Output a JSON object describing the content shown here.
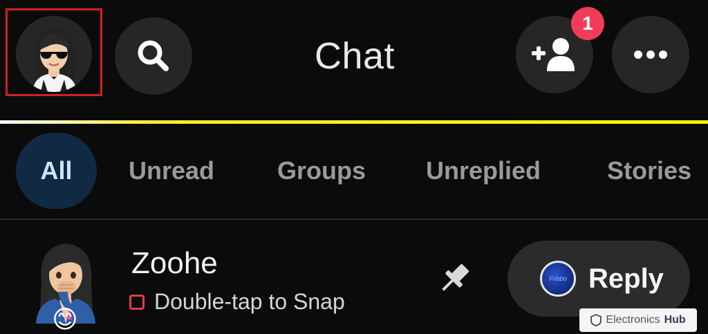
{
  "header": {
    "title": "Chat",
    "notification_count": "1"
  },
  "tabs": [
    {
      "label": "All",
      "selected": true
    },
    {
      "label": "Unread",
      "selected": false
    },
    {
      "label": "Groups",
      "selected": false
    },
    {
      "label": "Unreplied",
      "selected": false
    },
    {
      "label": "Stories",
      "selected": false
    }
  ],
  "chat": {
    "name": "Zoohe",
    "status": "Double-tap to Snap",
    "emoji": "😊",
    "reply_label": "Reply",
    "reply_thumb_text": "Fribbo"
  },
  "icons": {
    "search": "search-icon",
    "add_friend": "add-friend-icon",
    "more": "more-icon",
    "pin": "pin-icon"
  },
  "colors": {
    "background": "#0b0b0b",
    "button": "#262626",
    "accent_yellow": "#fffc00",
    "badge": "#f23c57",
    "selected_tab": "#0f2a42",
    "highlight": "#d02026"
  },
  "watermark": {
    "brand": "Electronics",
    "suffix": "Hub"
  }
}
